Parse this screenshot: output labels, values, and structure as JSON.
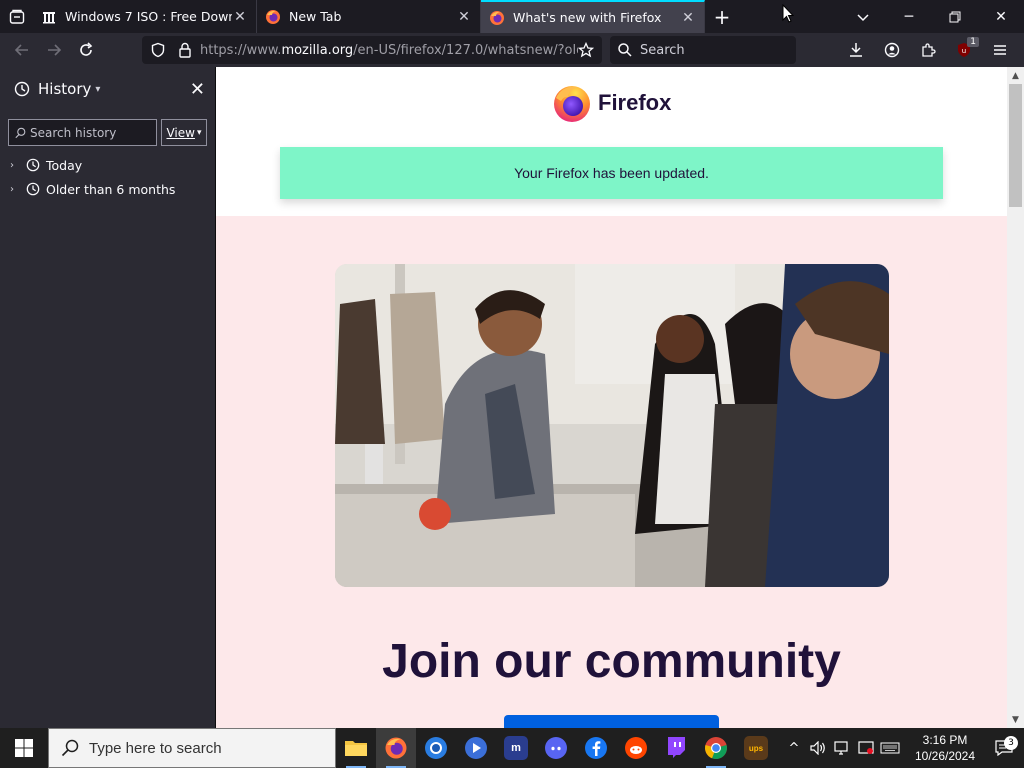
{
  "tabs": [
    {
      "title": "Windows 7 ISO : Free Download",
      "favicon": "archive-icon"
    },
    {
      "title": "New Tab",
      "favicon": "firefox-icon"
    },
    {
      "title": "What's new with Firefox",
      "favicon": "firefox-icon",
      "active": true
    }
  ],
  "navbar": {
    "url_prefix": "https://www.",
    "url_domain": "mozilla.org",
    "url_rest": "/en-US/firefox/127.0/whatsnew/?old",
    "search_placeholder": "Search",
    "extension_badge": "1"
  },
  "sidebar": {
    "title": "History",
    "search_placeholder": "Search history",
    "view_label": "View",
    "items": [
      {
        "label": "Today"
      },
      {
        "label": "Older than 6 months"
      }
    ]
  },
  "page": {
    "brand": "Firefox",
    "notice": "Your Firefox has been updated.",
    "heading": "Join our community"
  },
  "taskbar": {
    "search_placeholder": "Type here to search",
    "apps": [
      "file-explorer",
      "firefox",
      "chrome-canary",
      "media-player",
      "meetup",
      "discord",
      "facebook",
      "reddit",
      "twitch",
      "chrome",
      "ups"
    ],
    "time": "3:16 PM",
    "date": "10/26/2024",
    "notification_count": "3"
  }
}
